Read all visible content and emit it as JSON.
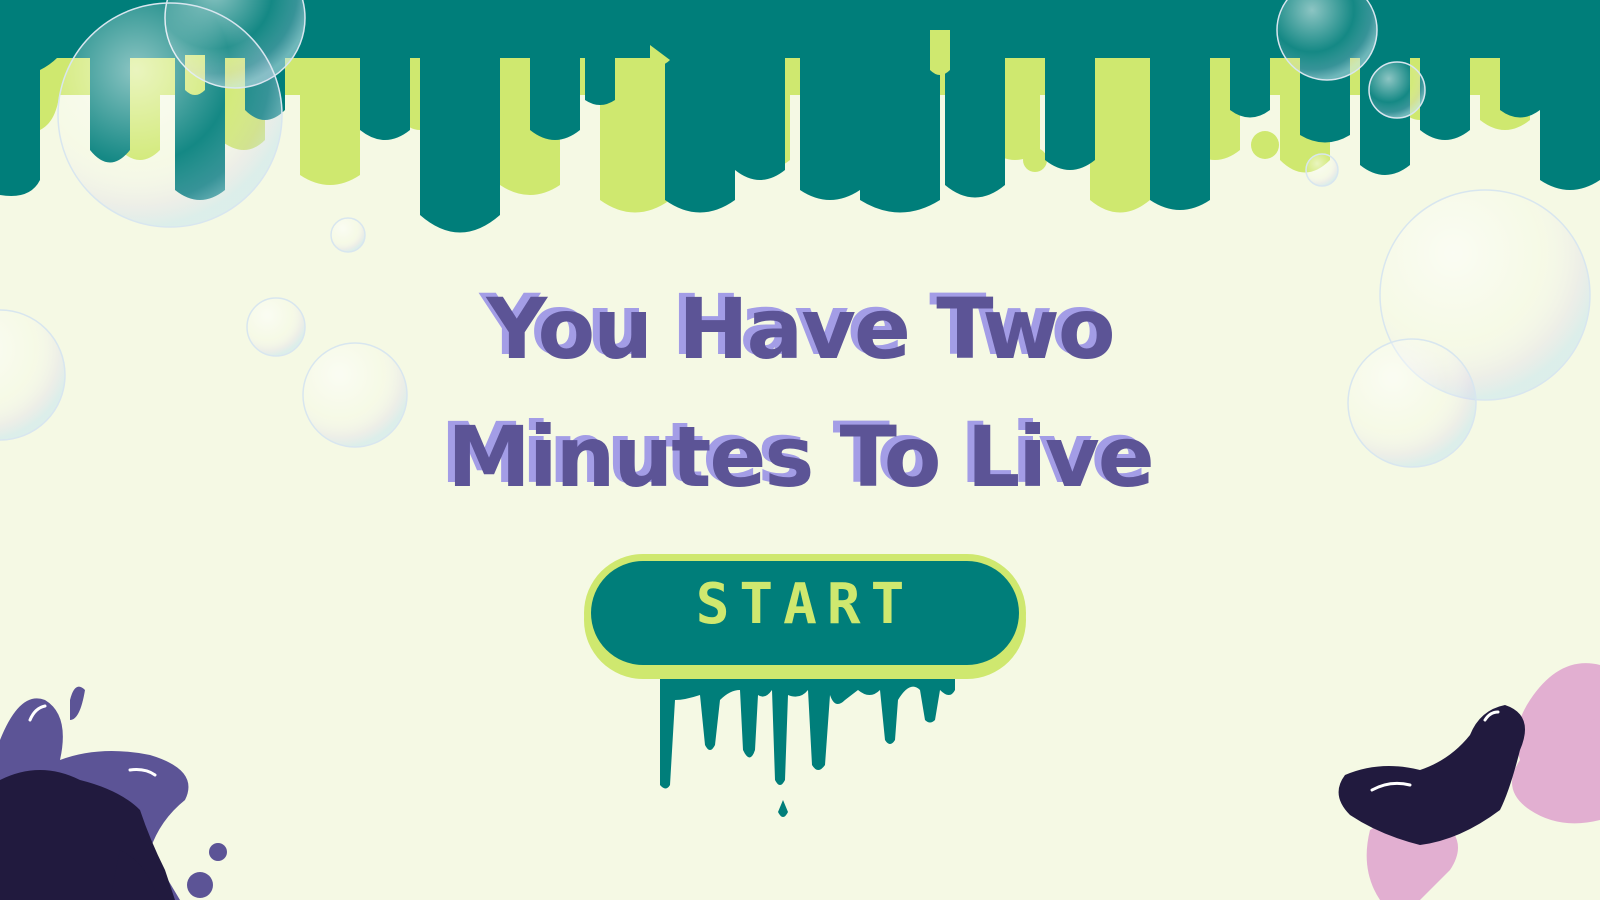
{
  "title": {
    "line1": "You Have Two",
    "line2": "Minutes To Live"
  },
  "start_button": {
    "label": "START"
  },
  "colors": {
    "background": "#f5f9e4",
    "slime_teal": "#007e7a",
    "slime_lime": "#cfe86f",
    "title_purple": "#5c5496",
    "title_shadow": "#a39de6",
    "splat_dark": "#211a3e",
    "splat_purple": "#5c5496",
    "splat_pink": "#e2afd1"
  },
  "icons": {
    "slime_drip": "slime-drip-icon",
    "bubble": "bubble-icon",
    "paint_splat": "paint-splat-icon"
  }
}
